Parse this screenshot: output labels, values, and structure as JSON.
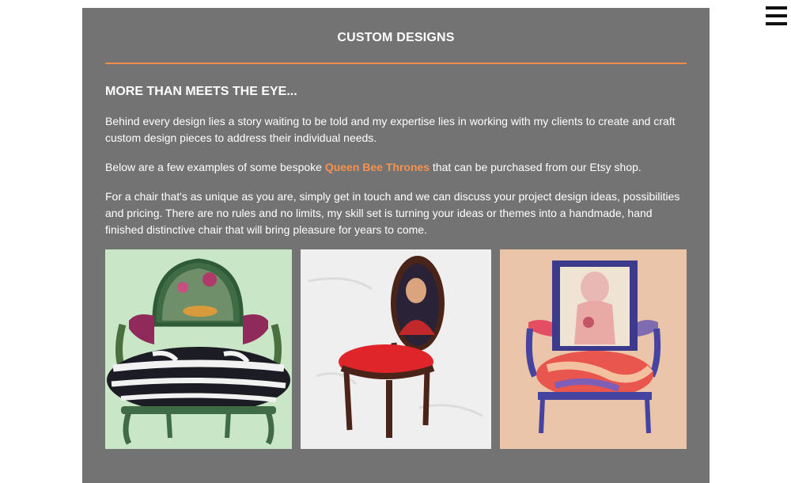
{
  "header": {
    "menu_icon": "hamburger-menu-icon"
  },
  "section": {
    "title": "CUSTOM DESIGNS",
    "subheading": "MORE THAN MEETS THE EYE...",
    "para1": "Behind every design lies a story waiting to be told and my expertise lies in working with my clients to create and craft custom design pieces to address their individual needs.",
    "para2_before": "Below are a few examples of some bespoke ",
    "para2_link": "Queen Bee Thrones",
    "para2_after": " that can be purchased from our Etsy shop.",
    "para3": "For a chair that's as unique as you are, simply get in touch and we can discuss your project design ideas, possibilities and pricing. There are no rules and no limits, my skill set is turning your ideas or themes into a handmade, hand finished distinctive chair that will bring pleasure for years to come."
  },
  "colors": {
    "panel": "#737373",
    "accent": "#f08a4b",
    "link": "#f6914f"
  }
}
